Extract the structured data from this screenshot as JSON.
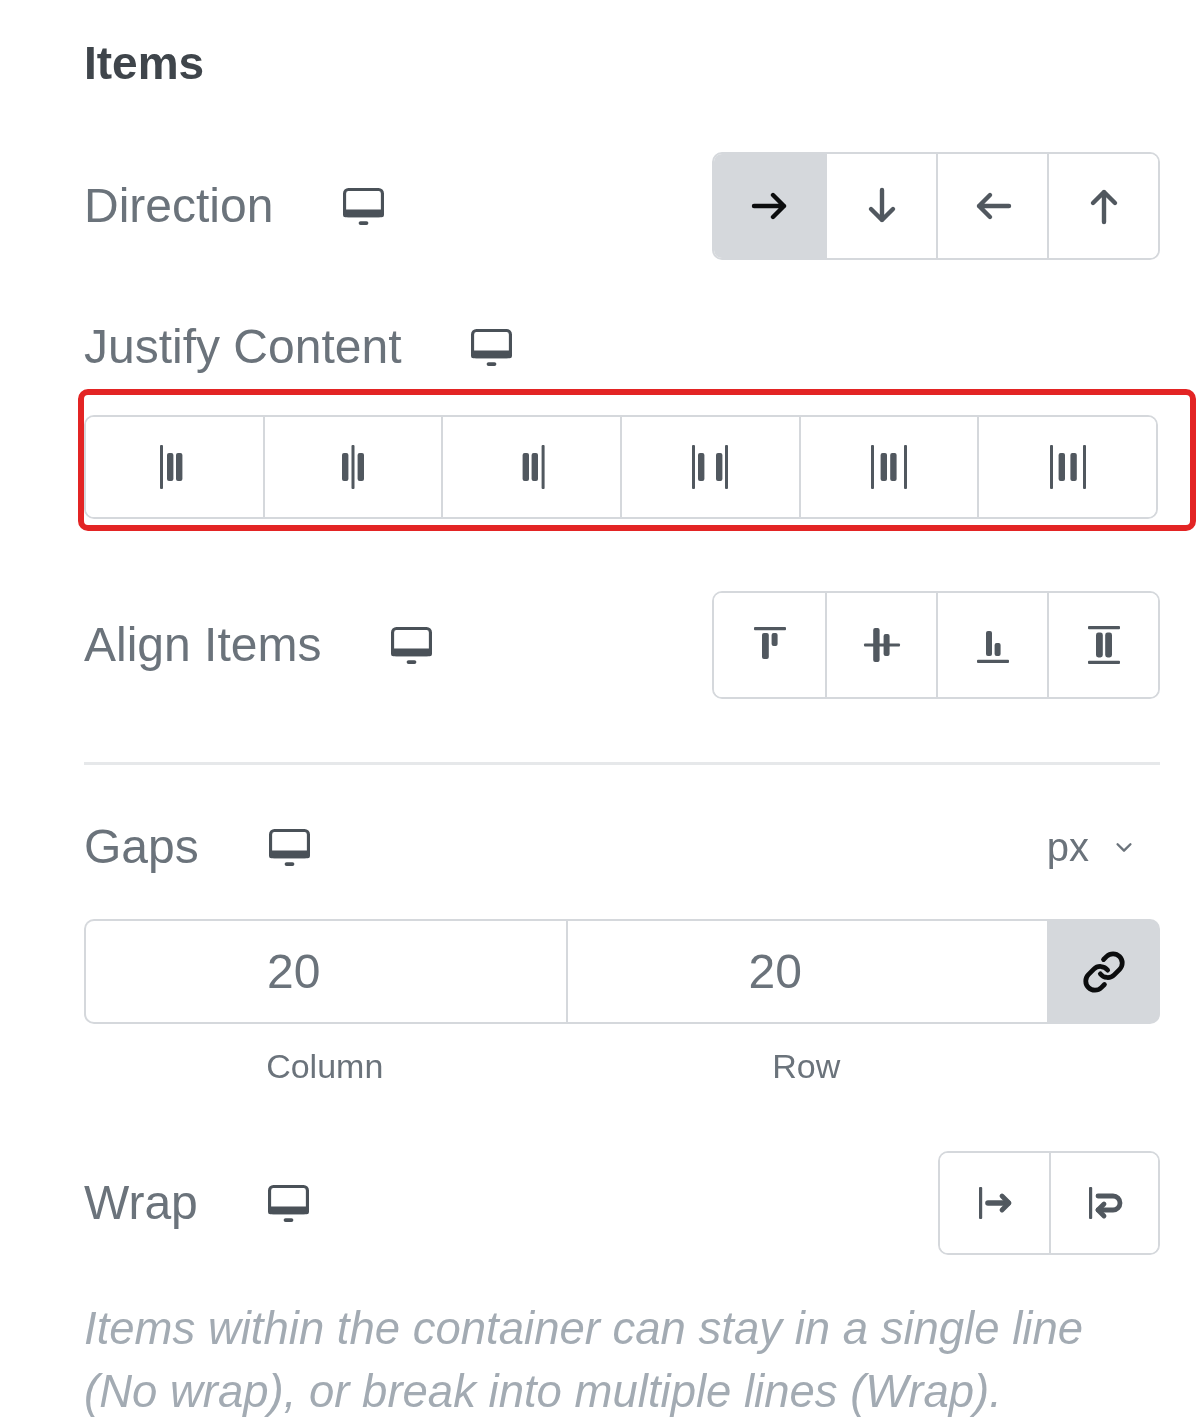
{
  "section": {
    "title": "Items"
  },
  "controls": [
    {
      "kind": "direction",
      "label": "Direction",
      "responsive": true,
      "highlighted": false,
      "options": [
        {
          "selected": true
        },
        {
          "selected": false
        },
        {
          "selected": false
        },
        {
          "selected": false
        }
      ]
    },
    {
      "kind": "justify",
      "label": "Justify Content",
      "responsive": true,
      "highlighted": true,
      "options": [
        {
          "selected": false
        },
        {
          "selected": false
        },
        {
          "selected": false
        },
        {
          "selected": false
        },
        {
          "selected": false
        },
        {
          "selected": false
        }
      ]
    },
    {
      "kind": "align",
      "label": "Align Items",
      "responsive": true,
      "highlighted": false,
      "options": [
        {
          "selected": false
        },
        {
          "selected": false
        },
        {
          "selected": false
        },
        {
          "selected": false
        }
      ]
    },
    {
      "kind": "divider"
    },
    {
      "kind": "gaps",
      "label": "Gaps",
      "responsive": true,
      "unit": "px",
      "linked": true,
      "fields": [
        {
          "value": "20",
          "caption": "Column"
        },
        {
          "value": "20",
          "caption": "Row"
        }
      ]
    },
    {
      "kind": "wrap",
      "label": "Wrap",
      "responsive": true,
      "highlighted": false,
      "options": [
        {
          "selected": false
        },
        {
          "selected": false
        }
      ]
    },
    {
      "kind": "note",
      "text": "Items within the container can stay in a single line (No wrap), or break into multiple lines (Wrap)."
    }
  ]
}
